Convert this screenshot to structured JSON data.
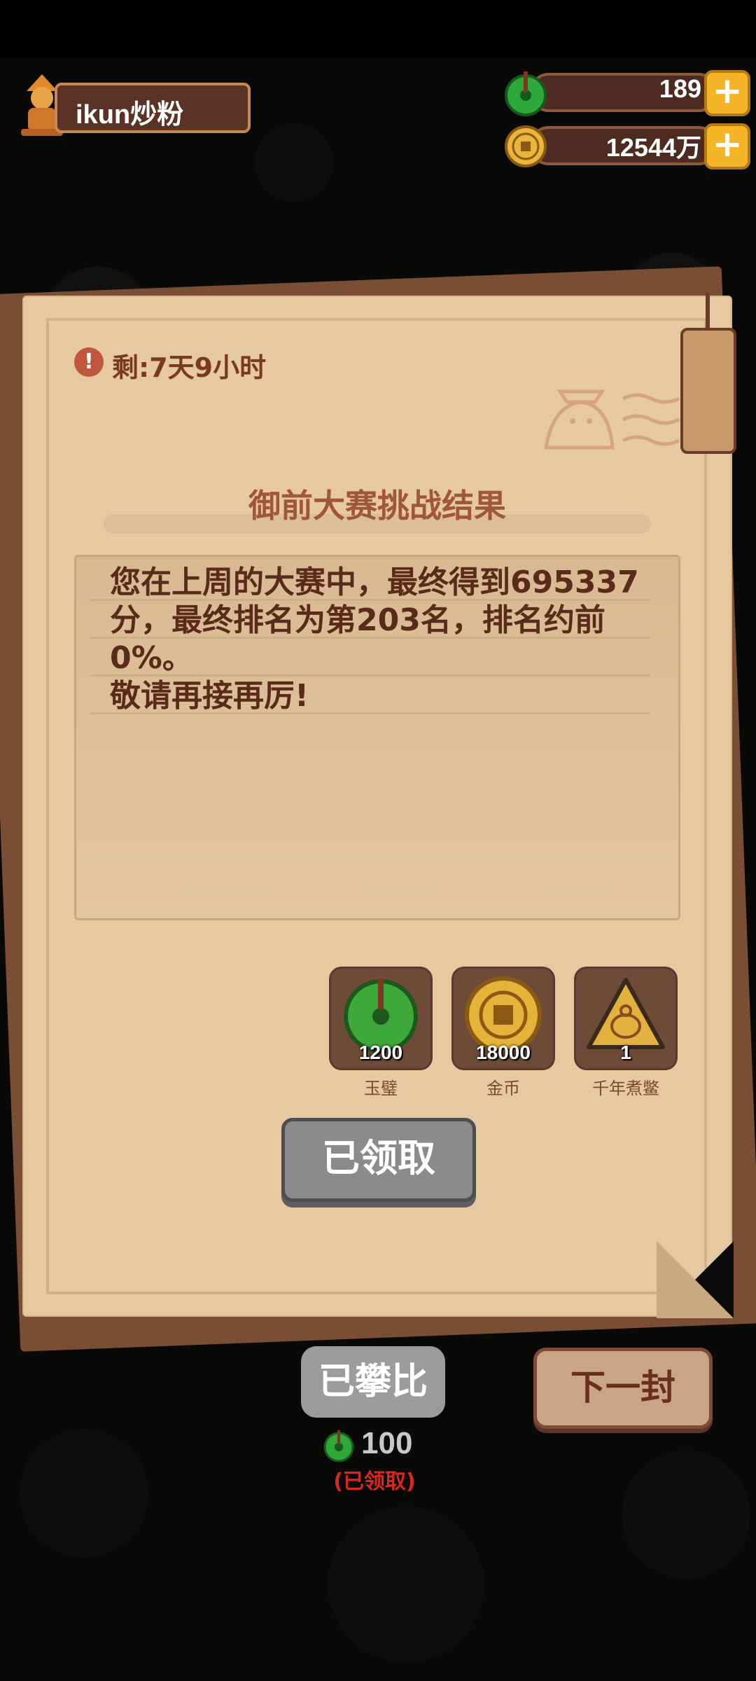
{
  "player": {
    "name": "ikun炒粉"
  },
  "currencies": {
    "jade": {
      "value": "189"
    },
    "gold": {
      "value": "12544万"
    }
  },
  "letter": {
    "timer": "剩:7天9小时",
    "title": "御前大赛挑战结果",
    "message": "您在上周的大赛中，最终得到695337分，最终排名为第203名，排名约前 0%。\n敬请再接再厉!",
    "rewards": [
      {
        "icon": "jade-icon",
        "count": "1200",
        "label": "玉璧"
      },
      {
        "icon": "gold-coin-icon",
        "count": "18000",
        "label": "金币"
      },
      {
        "icon": "turtle-icon",
        "count": "1",
        "label": "千年煮鳖"
      }
    ],
    "claim_button": "已领取"
  },
  "bottom": {
    "climb_button": "已攀比",
    "cost_value": "100",
    "cost_status": "(已领取)",
    "next_button": "下一封"
  },
  "colors": {
    "paper": "#e7c9a1",
    "accent_brown": "#7a3a22",
    "gold": "#f5b526",
    "claimed_red": "#d8281c"
  }
}
